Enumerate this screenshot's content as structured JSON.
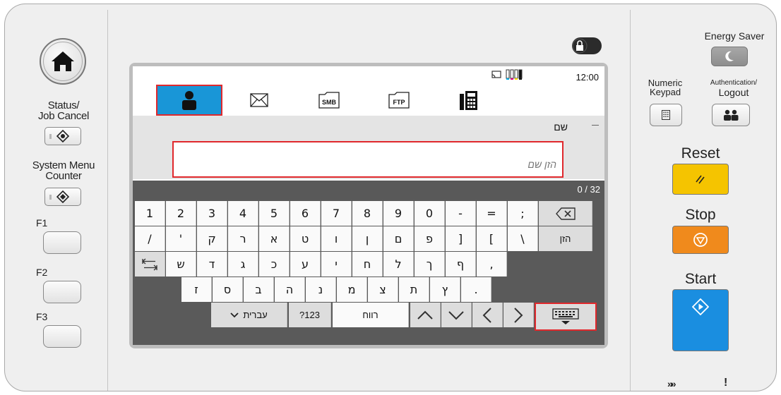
{
  "left_panel": {
    "status_label_line1": "Status/",
    "status_label_line2": "Job Cancel",
    "system_menu_line1": "System Menu",
    "system_menu_line2": "Counter",
    "f1": "F1",
    "f2": "F2",
    "f3": "F3"
  },
  "status_bar": {
    "time": "12:00"
  },
  "tabs": [
    {
      "name": "address-book-tab",
      "icon": "person-icon",
      "active": true
    },
    {
      "name": "email-tab",
      "icon": "envelope-icon"
    },
    {
      "name": "smb-tab",
      "icon": "smb-folder-icon",
      "label": "SMB"
    },
    {
      "name": "ftp-tab",
      "icon": "ftp-folder-icon",
      "label": "FTP"
    },
    {
      "name": "fax-tab",
      "icon": "fax-icon"
    }
  ],
  "field": {
    "label": "שם",
    "placeholder": "הזן שם",
    "value": "",
    "counter": "0 / 32"
  },
  "keyboard": {
    "row1": [
      "1",
      "2",
      "3",
      "4",
      "5",
      "6",
      "7",
      "8",
      "9",
      "0",
      "-",
      "=",
      ";"
    ],
    "row2": [
      "/",
      "'",
      "ק",
      "ר",
      "א",
      "ט",
      "ו",
      "ן",
      "ם",
      "פ",
      "]",
      "[",
      "\\"
    ],
    "enter": "הזן",
    "row3": [
      "ש",
      "ד",
      "ג",
      "כ",
      "ע",
      "י",
      "ח",
      "ל",
      "ך",
      "ף",
      ","
    ],
    "row4": [
      "ז",
      "ס",
      "ב",
      "ה",
      "נ",
      "מ",
      "צ",
      "ת",
      "ץ",
      "."
    ],
    "language": "עברית",
    "numeric": "?123",
    "space": "רווח"
  },
  "right_panel": {
    "energy_saver": "Energy Saver",
    "numeric_line1": "Numeric",
    "numeric_line2": "Keypad",
    "auth_line1": "Authentication/",
    "auth_line2": "Logout",
    "reset": "Reset",
    "stop": "Stop",
    "start": "Start"
  },
  "colors": {
    "accent_blue": "#1996d7",
    "highlight_red": "#e0282c",
    "reset_yellow": "#f5c400",
    "stop_orange": "#f08a1c",
    "start_blue": "#1a8ee0"
  }
}
